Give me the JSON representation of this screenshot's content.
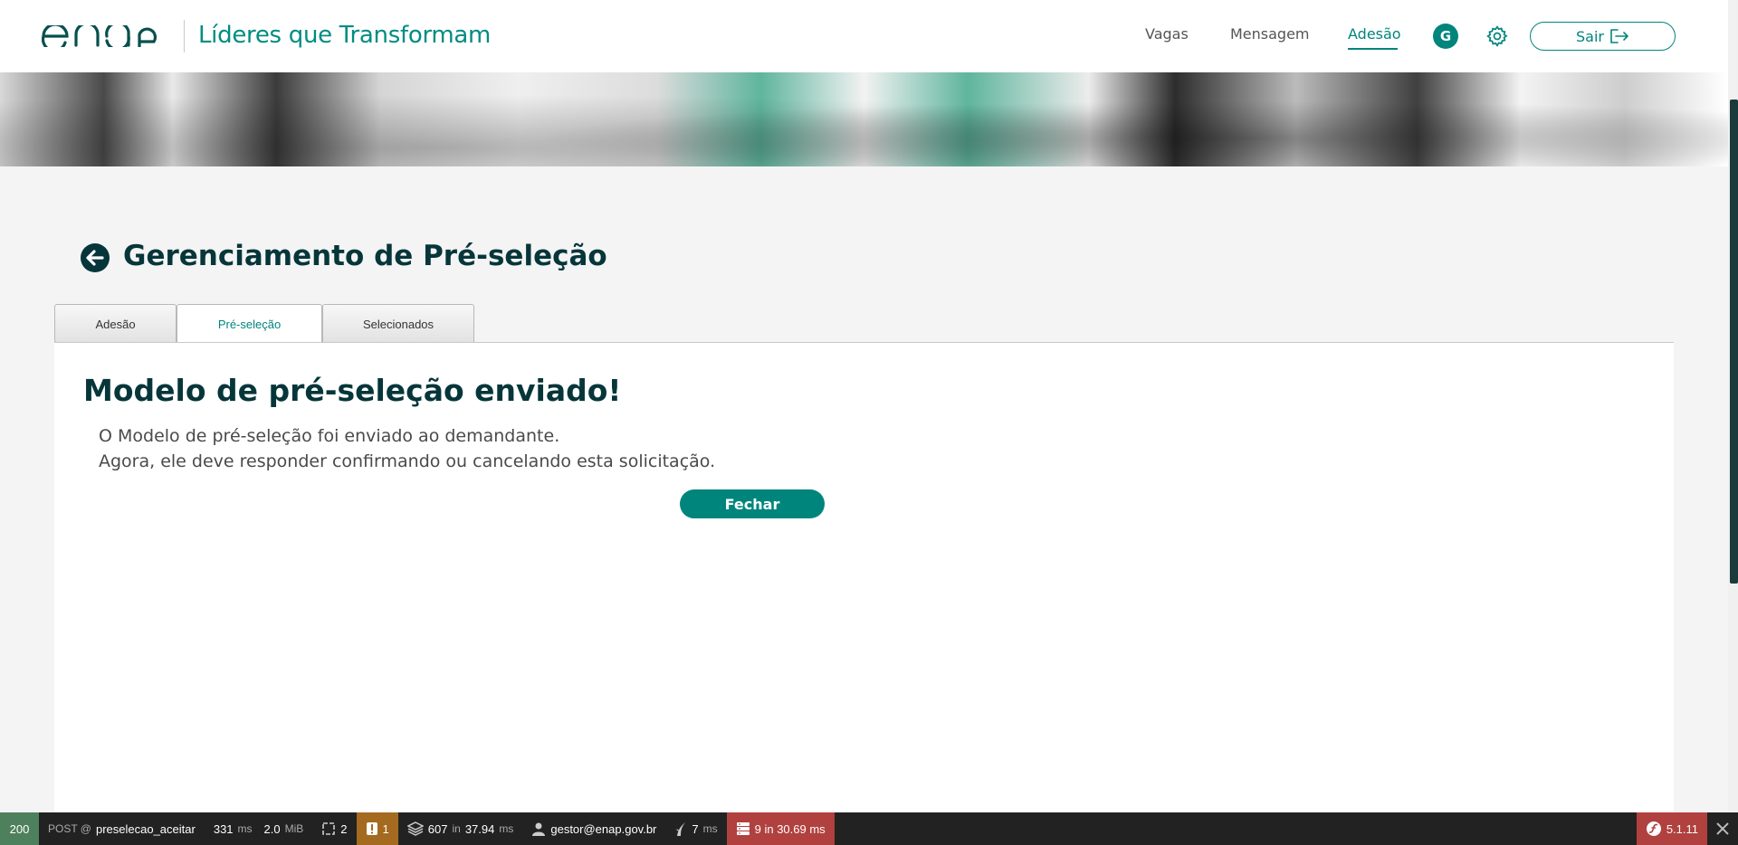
{
  "header": {
    "app_title": "Líderes que Transformam",
    "nav": {
      "vagas": "Vagas",
      "mensagem": "Mensagem",
      "adesao": "Adesão"
    },
    "avatar_initial": "G",
    "logout_label": "Sair"
  },
  "page": {
    "title": "Gerenciamento de Pré-seleção",
    "tabs": [
      {
        "label": "Adesão"
      },
      {
        "label": "Pré-seleção",
        "active": true
      },
      {
        "label": "Selecionados"
      }
    ]
  },
  "message": {
    "title": "Modelo de pré-seleção enviado!",
    "line1": "O Modelo de pré-seleção foi enviado ao demandante.",
    "line2": "Agora, ele deve responder confirmando ou cancelando esta solicitação.",
    "close_label": "Fechar"
  },
  "toolbar": {
    "status": "200",
    "method": "POST @",
    "route": "preselecao_aceitar",
    "time": "331",
    "time_unit": "ms",
    "memory": "2.0",
    "memory_unit": "MiB",
    "forms": "2",
    "logs": "1",
    "cache": "607",
    "cache_in": "in",
    "cache_time": "37.94",
    "cache_unit": "ms",
    "user": "gestor@enap.gov.br",
    "twig": "7",
    "twig_unit": "ms",
    "db": "9 in 30.69 ms",
    "version": "5.1.11"
  },
  "colors": {
    "brand": "#00857c",
    "dark_title": "#06363a",
    "toolbar": "#222222"
  }
}
